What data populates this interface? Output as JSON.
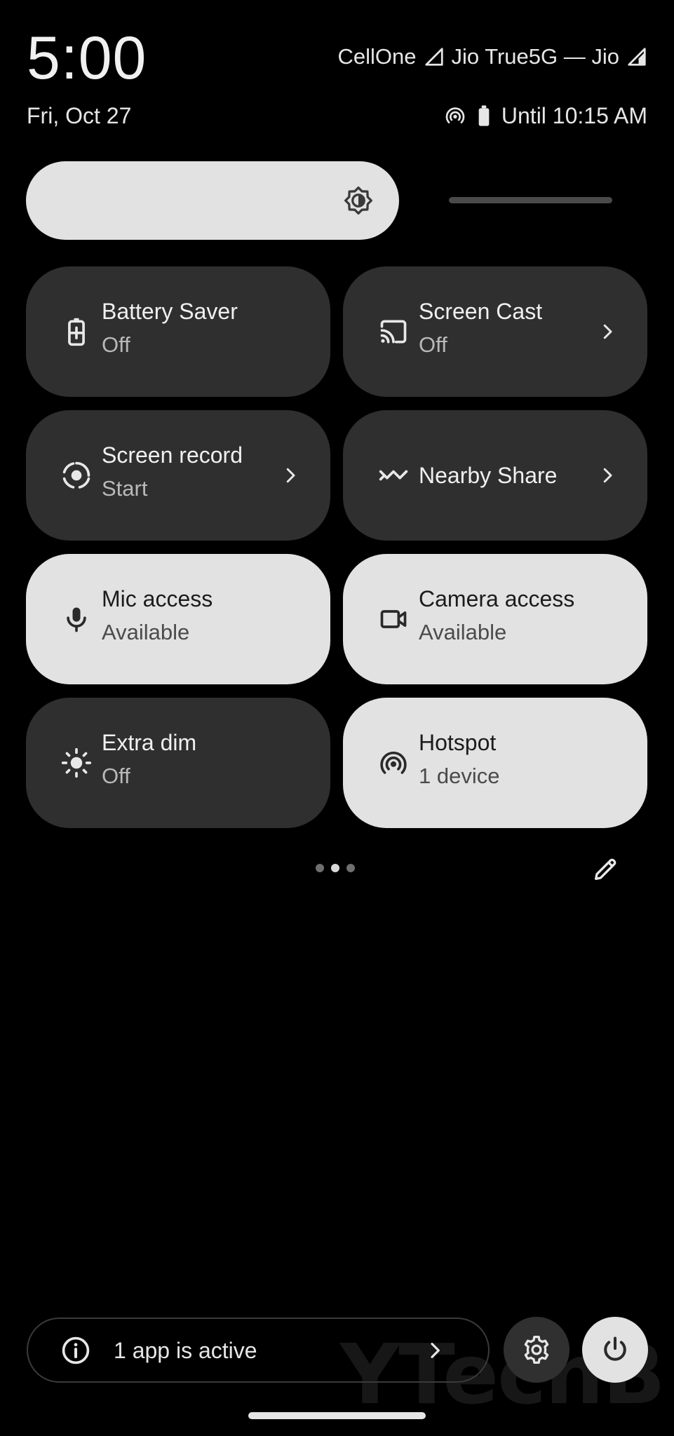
{
  "status_bar": {
    "time": "5:00",
    "date": "Fri, Oct 27",
    "carrier_1": "CellOne",
    "carrier_2": "Jio True5G — Jio",
    "battery_text": "Until 10:15 AM",
    "icons": [
      "signal-icon",
      "hotspot-status-icon",
      "battery-icon"
    ]
  },
  "brightness": {
    "level_fraction": 0.58,
    "icon": "brightness-icon"
  },
  "tiles": [
    {
      "label": "Battery Saver",
      "state": "Off",
      "icon": "battery-saver-icon",
      "active": false,
      "has_chevron": false
    },
    {
      "label": "Screen Cast",
      "state": "Off",
      "icon": "cast-icon",
      "active": false,
      "has_chevron": true
    },
    {
      "label": "Screen record",
      "state": "Start",
      "icon": "screen-record-icon",
      "active": false,
      "has_chevron": true
    },
    {
      "label": "Nearby Share",
      "state": "",
      "icon": "nearby-share-icon",
      "active": false,
      "has_chevron": true
    },
    {
      "label": "Mic access",
      "state": "Available",
      "icon": "mic-icon",
      "active": true,
      "has_chevron": false
    },
    {
      "label": "Camera access",
      "state": "Available",
      "icon": "camera-icon",
      "active": true,
      "has_chevron": false
    },
    {
      "label": "Extra dim",
      "state": "Off",
      "icon": "extra-dim-icon",
      "active": false,
      "has_chevron": false
    },
    {
      "label": "Hotspot",
      "state": "1 device",
      "icon": "hotspot-icon",
      "active": true,
      "has_chevron": false
    }
  ],
  "pager": {
    "pages": 3,
    "current": 2
  },
  "footer": {
    "active_apps_text": "1 app is active",
    "watermark": "YTechB",
    "buttons": [
      "settings-icon",
      "power-icon"
    ]
  },
  "colors": {
    "background": "#000000",
    "tile_off": "#2f2f2f",
    "tile_on": "#e2e2e2"
  }
}
